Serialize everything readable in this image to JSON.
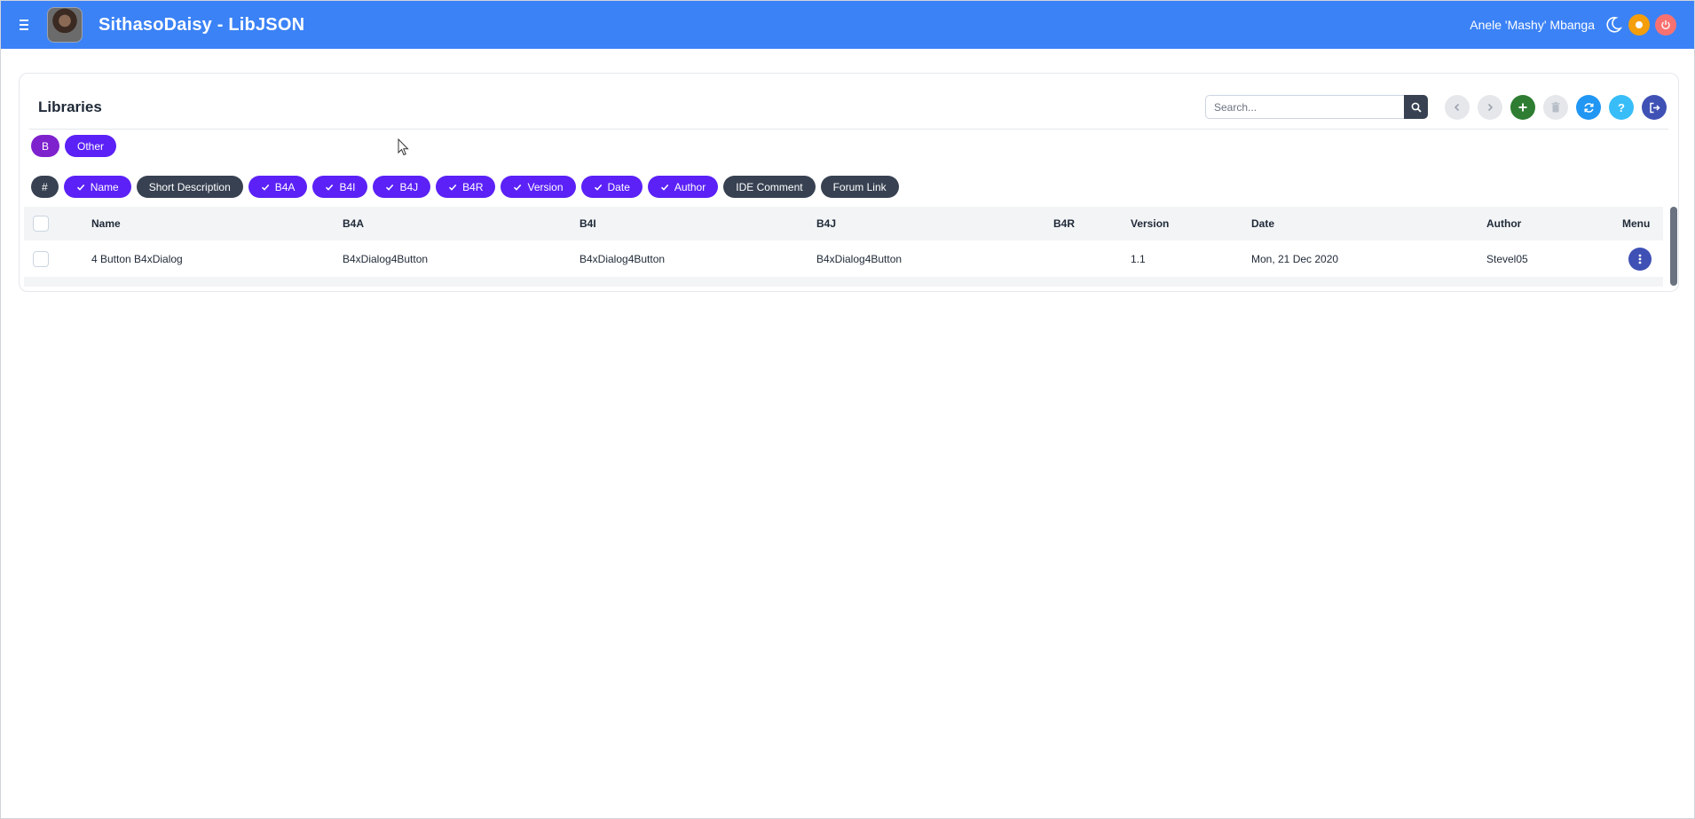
{
  "header": {
    "menu_icon": "hamburger-icon",
    "title": "SithasoDaisy - LibJSON",
    "user_name": "Anele 'Mashy' Mbanga",
    "icons": [
      "moon-icon",
      "theme-icon",
      "power-icon"
    ],
    "colors": {
      "bar": "#3b82f6",
      "theme": "#f59e0b",
      "power": "#f87171"
    }
  },
  "card": {
    "title": "Libraries",
    "search": {
      "placeholder": "Search..."
    },
    "toolbar": [
      {
        "name": "prev-button",
        "icon": "chevron-left-icon"
      },
      {
        "name": "next-button",
        "icon": "chevron-right-icon"
      },
      {
        "name": "add-button",
        "icon": "plus-icon"
      },
      {
        "name": "delete-button",
        "icon": "trash-icon"
      },
      {
        "name": "refresh-button",
        "icon": "refresh-icon"
      },
      {
        "name": "help-button",
        "icon": "question-icon"
      },
      {
        "name": "logout-button",
        "icon": "logout-icon"
      }
    ]
  },
  "filters": [
    {
      "label": "B",
      "color": "#7e22ce"
    },
    {
      "label": "Other",
      "color": "#5b21f6"
    }
  ],
  "column_toggles": [
    {
      "label": "#",
      "checked": false
    },
    {
      "label": "Name",
      "checked": true
    },
    {
      "label": "Short Description",
      "checked": false
    },
    {
      "label": "B4A",
      "checked": true
    },
    {
      "label": "B4I",
      "checked": true
    },
    {
      "label": "B4J",
      "checked": true
    },
    {
      "label": "B4R",
      "checked": true
    },
    {
      "label": "Version",
      "checked": true
    },
    {
      "label": "Date",
      "checked": true
    },
    {
      "label": "Author",
      "checked": true
    },
    {
      "label": "IDE Comment",
      "checked": false
    },
    {
      "label": "Forum Link",
      "checked": false
    }
  ],
  "table": {
    "headers": [
      "Name",
      "B4A",
      "B4I",
      "B4J",
      "B4R",
      "Version",
      "Date",
      "Author",
      "Menu"
    ],
    "rows": [
      [
        "4 Button B4xDialog",
        "B4xDialog4Button",
        "B4xDialog4Button",
        "B4xDialog4Button",
        "",
        "1.1",
        "Mon, 21 Dec 2020",
        "Stevel05",
        ""
      ]
    ]
  }
}
